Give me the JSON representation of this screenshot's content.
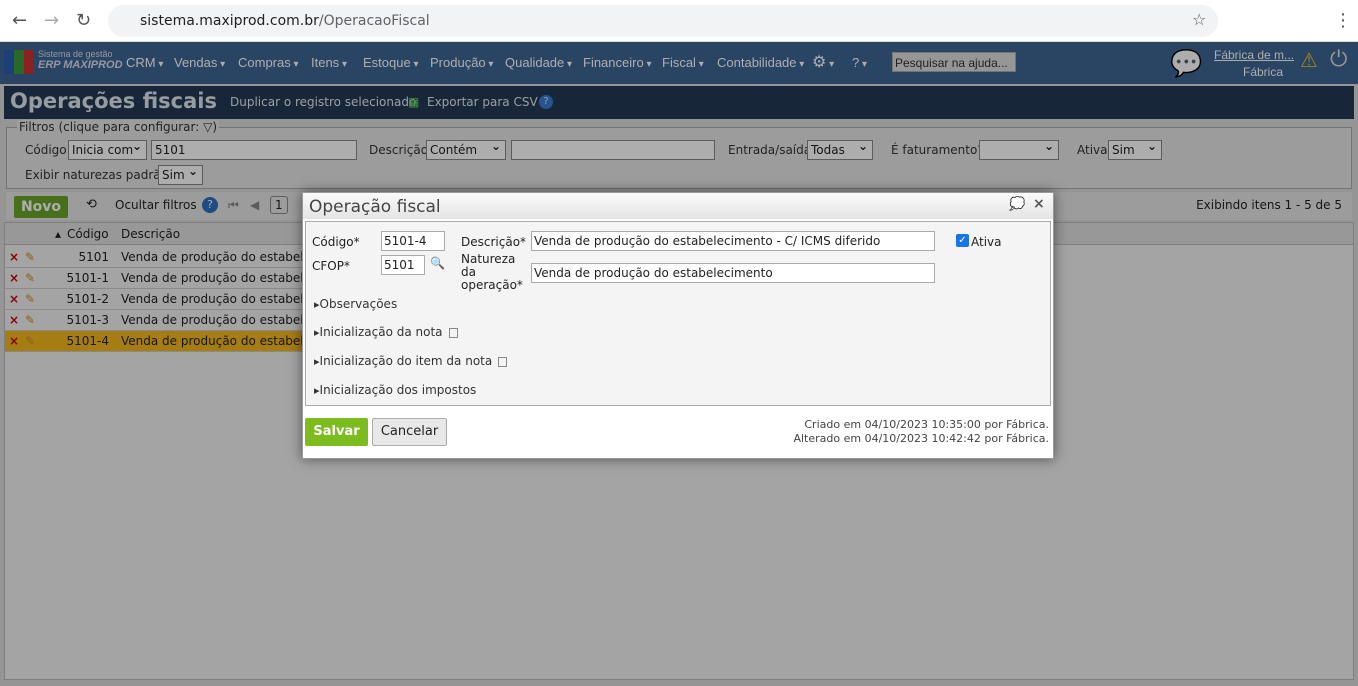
{
  "browser": {
    "url_domain": "sistema.maxiprod.com.br",
    "url_path": "/OperacaoFiscal"
  },
  "nav": {
    "logo_line1": "Sistema de gestão",
    "logo_line2": "ERP MAXIPROD",
    "menus": [
      "CRM",
      "Vendas",
      "Compras",
      "Itens",
      "Estoque",
      "Produção",
      "Qualidade",
      "Financeiro",
      "Fiscal",
      "Contabilidade"
    ],
    "help_search_placeholder": "Pesquisar na ajuda...",
    "company": "Fábrica de m...",
    "user": "Fábrica"
  },
  "page": {
    "title": "Operações fiscais",
    "duplicate": "Duplicar o registro selecionado",
    "export": "Exportar para CSV"
  },
  "filters": {
    "legend": "Filtros (clique para configurar:",
    "codigo_label": "Código",
    "codigo_op": "Inicia com",
    "codigo_value": "5101",
    "descricao_label": "Descrição",
    "descricao_op": "Contém",
    "descricao_value": "",
    "es_label": "Entrada/saída",
    "es_value": "Todas",
    "fat_label": "É faturamento?",
    "fat_value": "",
    "ativa_label": "Ativa",
    "ativa_value": "Sim",
    "exibir_label": "Exibir naturezas padrão",
    "exibir_value": "Sim"
  },
  "toolbar": {
    "novo": "Novo",
    "ocultar": "Ocultar filtros",
    "page": "1",
    "status": "Exibindo itens 1 - 5 de 5"
  },
  "grid": {
    "headers": [
      "Código",
      "Descrição"
    ],
    "rows": [
      {
        "code": "5101",
        "desc": "Venda de produção do estabelecimento"
      },
      {
        "code": "5101-1",
        "desc": "Venda de produção do estabelecimento"
      },
      {
        "code": "5101-2",
        "desc": "Venda de produção do estabelecimento"
      },
      {
        "code": "5101-3",
        "desc": "Venda de produção do estabelecimento"
      },
      {
        "code": "5101-4",
        "desc": "Venda de produção do estabelecimento"
      }
    ]
  },
  "modal": {
    "title": "Operação fiscal",
    "codigo_label": "Código*",
    "codigo": "5101-4",
    "cfop_label": "CFOP*",
    "cfop": "5101",
    "descricao_label": "Descrição*",
    "descricao": "Venda de produção do estabelecimento - C/ ICMS diferido",
    "natureza_label": "Natureza da operação*",
    "natureza": "Venda de produção do estabelecimento",
    "ativa_label": "Ativa",
    "ativa_checked": true,
    "sections": [
      "Observações",
      "Inicialização da nota",
      "Inicialização do item da nota",
      "Inicialização dos impostos"
    ],
    "salvar": "Salvar",
    "cancelar": "Cancelar",
    "criado": "Criado em 04/10/2023 10:35:00 por Fábrica.",
    "alterado": "Alterado em 04/10/2023 10:42:42 por Fábrica."
  }
}
